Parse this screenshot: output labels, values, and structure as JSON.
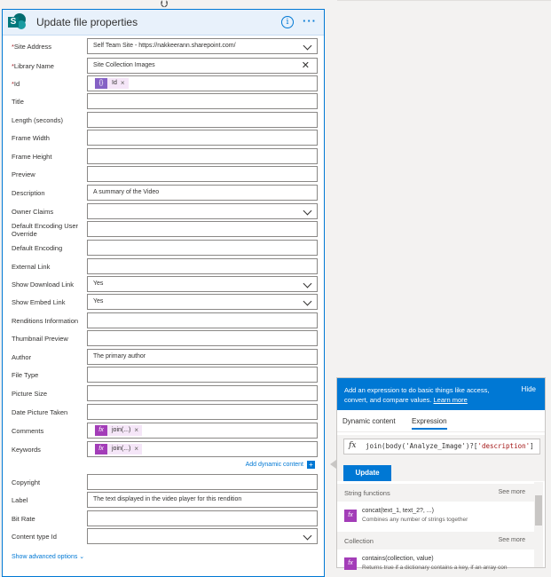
{
  "action": {
    "title": "Update file properties",
    "logo_letter": "S",
    "fields": [
      {
        "label": "Site Address",
        "required": true,
        "value": "Self Team Site - https://nakkeerann.sharepoint.com/",
        "control": "dropdown"
      },
      {
        "label": "Library Name",
        "required": true,
        "value": "Site Collection Images",
        "control": "clearable"
      },
      {
        "label": "Id",
        "required": true,
        "value": "",
        "control": "token",
        "token": "Id"
      },
      {
        "label": "Title",
        "value": "",
        "control": "text"
      },
      {
        "label": "Length (seconds)",
        "value": "",
        "control": "text"
      },
      {
        "label": "Frame Width",
        "value": "",
        "control": "text"
      },
      {
        "label": "Frame Height",
        "value": "",
        "control": "text"
      },
      {
        "label": "Preview",
        "value": "",
        "control": "text"
      },
      {
        "label": "Description",
        "value": "A summary of the Video",
        "control": "text"
      },
      {
        "label": "Owner Claims",
        "value": "",
        "control": "dropdown"
      },
      {
        "label": "Default Encoding User Override",
        "value": "",
        "control": "text"
      },
      {
        "label": "Default Encoding",
        "value": "",
        "control": "text"
      },
      {
        "label": "External Link",
        "value": "",
        "control": "text"
      },
      {
        "label": "Show Download Link",
        "value": "Yes",
        "control": "dropdown"
      },
      {
        "label": "Show Embed Link",
        "value": "Yes",
        "control": "dropdown"
      },
      {
        "label": "Renditions Information",
        "value": "",
        "control": "text"
      },
      {
        "label": "Thumbnail Preview",
        "value": "",
        "control": "text"
      },
      {
        "label": "Author",
        "value": "The primary author",
        "control": "text"
      },
      {
        "label": "File Type",
        "value": "",
        "control": "text"
      },
      {
        "label": "Picture Size",
        "value": "",
        "control": "text"
      },
      {
        "label": "Date Picture Taken",
        "value": "",
        "control": "text"
      },
      {
        "label": "Comments",
        "value": "",
        "control": "token",
        "token": "join(...)"
      },
      {
        "label": "Keywords",
        "value": "",
        "control": "token",
        "token": "join(...)"
      },
      {
        "label": "Copyright",
        "value": "",
        "control": "text"
      },
      {
        "label": "Label",
        "value": "The text displayed in the video player for this rendition",
        "control": "text"
      },
      {
        "label": "Bit Rate",
        "value": "",
        "control": "text"
      },
      {
        "label": "Content type Id",
        "value": "",
        "control": "dropdown"
      }
    ],
    "add_dynamic_content": "Add dynamic content",
    "show_advanced_options": "Show advanced options",
    "token_close": "×",
    "fx_glyph": "fx",
    "id_glyph": "{}"
  },
  "expression_panel": {
    "message": "Add an expression to do basic things like access, convert, and compare values.",
    "learn_more": "Learn more",
    "hide": "Hide",
    "tabs": [
      "Dynamic content",
      "Expression"
    ],
    "expression_prefix": "join(body('Analyze_Image')?[",
    "expression_string": "'description'",
    "expression_suffix": "]",
    "update_label": "Update",
    "sections": [
      {
        "title": "String functions",
        "see_more": "See more",
        "items": [
          {
            "name": "concat(text_1, text_2?, ...)",
            "desc": "Combines any number of strings together"
          }
        ]
      },
      {
        "title": "Collection",
        "see_more": "See more",
        "items": [
          {
            "name": "contains(collection, value)",
            "desc": "Returns true if a dictionary contains a key, if an array con"
          }
        ]
      }
    ]
  },
  "colors": {
    "accent": "#0078d4",
    "fx_token": "#a33db8",
    "required": "#a4262c"
  }
}
